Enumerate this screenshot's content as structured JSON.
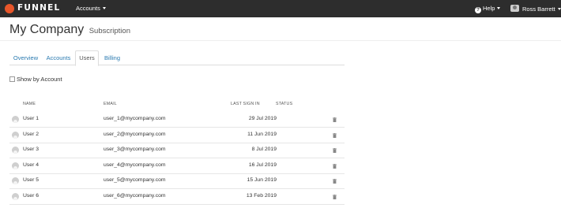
{
  "topbar": {
    "brand": "FUNNEL",
    "accounts_label": "Accounts",
    "help_label": "Help",
    "user_name": "Ross Barrett"
  },
  "header": {
    "title": "My Company",
    "subtitle": "Subscription"
  },
  "tabs": [
    {
      "label": "Overview"
    },
    {
      "label": "Accounts"
    },
    {
      "label": "Users",
      "active": true
    },
    {
      "label": "Billing"
    }
  ],
  "show_by_account_label": "Show by Account",
  "table": {
    "headers": {
      "name": "NAME",
      "email": "EMAIL",
      "last_sign_in": "LAST SIGN IN",
      "status": "STATUS"
    },
    "rows": [
      {
        "name": "User 1",
        "email": "user_1@mycompany.com",
        "last_sign_in": "29 Jul 2019"
      },
      {
        "name": "User 2",
        "email": "user_2@mycompany.com",
        "last_sign_in": "11 Jun 2019"
      },
      {
        "name": "User 3",
        "email": "user_3@mycompany.com",
        "last_sign_in": "8 Jul 2019"
      },
      {
        "name": "User 4",
        "email": "user_4@mycompany.com",
        "last_sign_in": "16 Jul 2019"
      },
      {
        "name": "User 5",
        "email": "user_5@mycompany.com",
        "last_sign_in": "15 Jun 2019"
      },
      {
        "name": "User 6",
        "email": "user_6@mycompany.com",
        "last_sign_in": "13 Feb 2019"
      }
    ]
  },
  "colors": {
    "topbar_bg": "#2d2d2d",
    "brand_orange": "#e8562a",
    "link_blue": "#2a7ab0"
  },
  "icons": {
    "brand": "funnel-logo-icon",
    "help": "question-circle-icon",
    "user": "user-avatar-icon",
    "row_avatar": "user-circle-icon",
    "delete": "trash-icon"
  }
}
